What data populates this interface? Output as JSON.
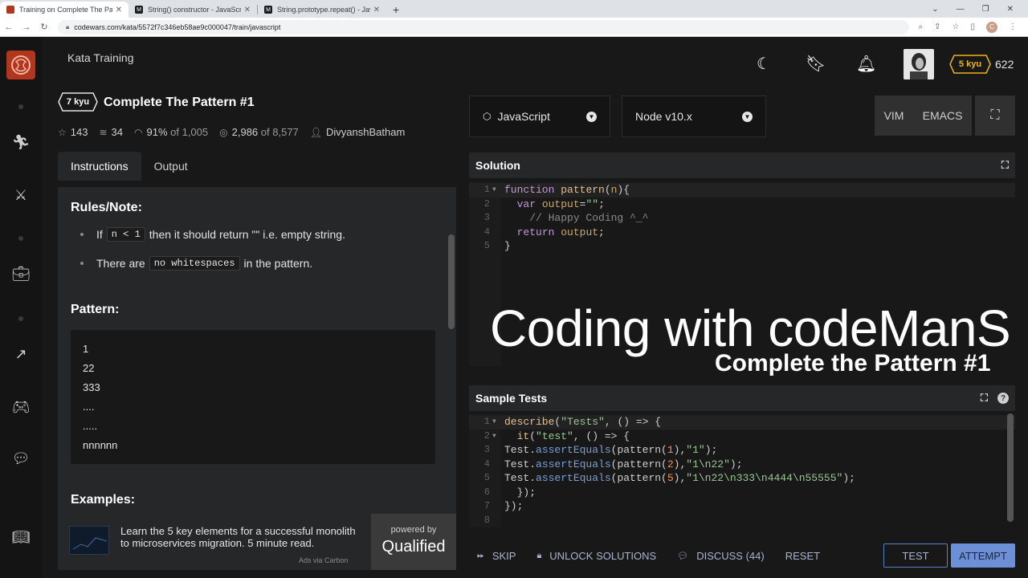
{
  "browser": {
    "tabs": [
      {
        "label": "Training on Complete The Pattern",
        "favicon": "codewars-icon",
        "active": true
      },
      {
        "label": "String() constructor - JavaScript |",
        "favicon": "mdn-icon",
        "active": false
      },
      {
        "label": "String.prototype.repeat() - JavaSc",
        "favicon": "mdn-icon",
        "active": false
      }
    ],
    "url": "codewars.com/kata/5572f7c346eb58ae9c000047/train/javascript",
    "profile_initial": "C"
  },
  "header": {
    "title": "Kata Training",
    "rank": "5 kyu",
    "honor": "622"
  },
  "kata": {
    "rank": "7 kyu",
    "title": "Complete The Pattern #1",
    "stats": {
      "stars": "143",
      "collections": "34",
      "satisfaction": "91%",
      "satisfaction_of": "of 1,005",
      "completed": "2,986",
      "completed_of": "of 8,577",
      "author": "DivyanshBatham"
    },
    "tabs": [
      "Instructions",
      "Output"
    ]
  },
  "instructions": {
    "rules_heading": "Rules/Note:",
    "rule1_pre": "If",
    "rule1_code": "n < 1",
    "rule1_post": "then it should return \"\" i.e. empty string.",
    "rule2_pre": "There are",
    "rule2_code": "no whitespaces",
    "rule2_post": "in the pattern.",
    "pattern_heading": "Pattern:",
    "pattern_lines": [
      "1",
      "22",
      "333",
      "....",
      ".....",
      "nnnnnn"
    ],
    "examples_heading": "Examples:"
  },
  "ad": {
    "text": "Learn the 5 key elements for a successful monolith to microservices migration. 5 minute read.",
    "via": "Ads via Carbon",
    "powered_by": "powered by",
    "brand": "Qualified"
  },
  "editor_controls": {
    "language": "JavaScript",
    "version": "Node v10.x",
    "modes": [
      "VIM",
      "EMACS"
    ]
  },
  "solution": {
    "heading": "Solution",
    "lines": [
      "1",
      "2",
      "3",
      "4",
      "5"
    ]
  },
  "overlay": {
    "line1": "Coding with codeManS",
    "line2": "Complete the Pattern #1"
  },
  "tests": {
    "heading": "Sample Tests",
    "lines": [
      "1",
      "2",
      "3",
      "4",
      "5",
      "6",
      "7",
      "8"
    ]
  },
  "actions": {
    "skip": "SKIP",
    "unlock": "UNLOCK SOLUTIONS",
    "discuss": "DISCUSS (44)",
    "reset": "RESET",
    "test": "TEST",
    "attempt": "ATTEMPT"
  }
}
